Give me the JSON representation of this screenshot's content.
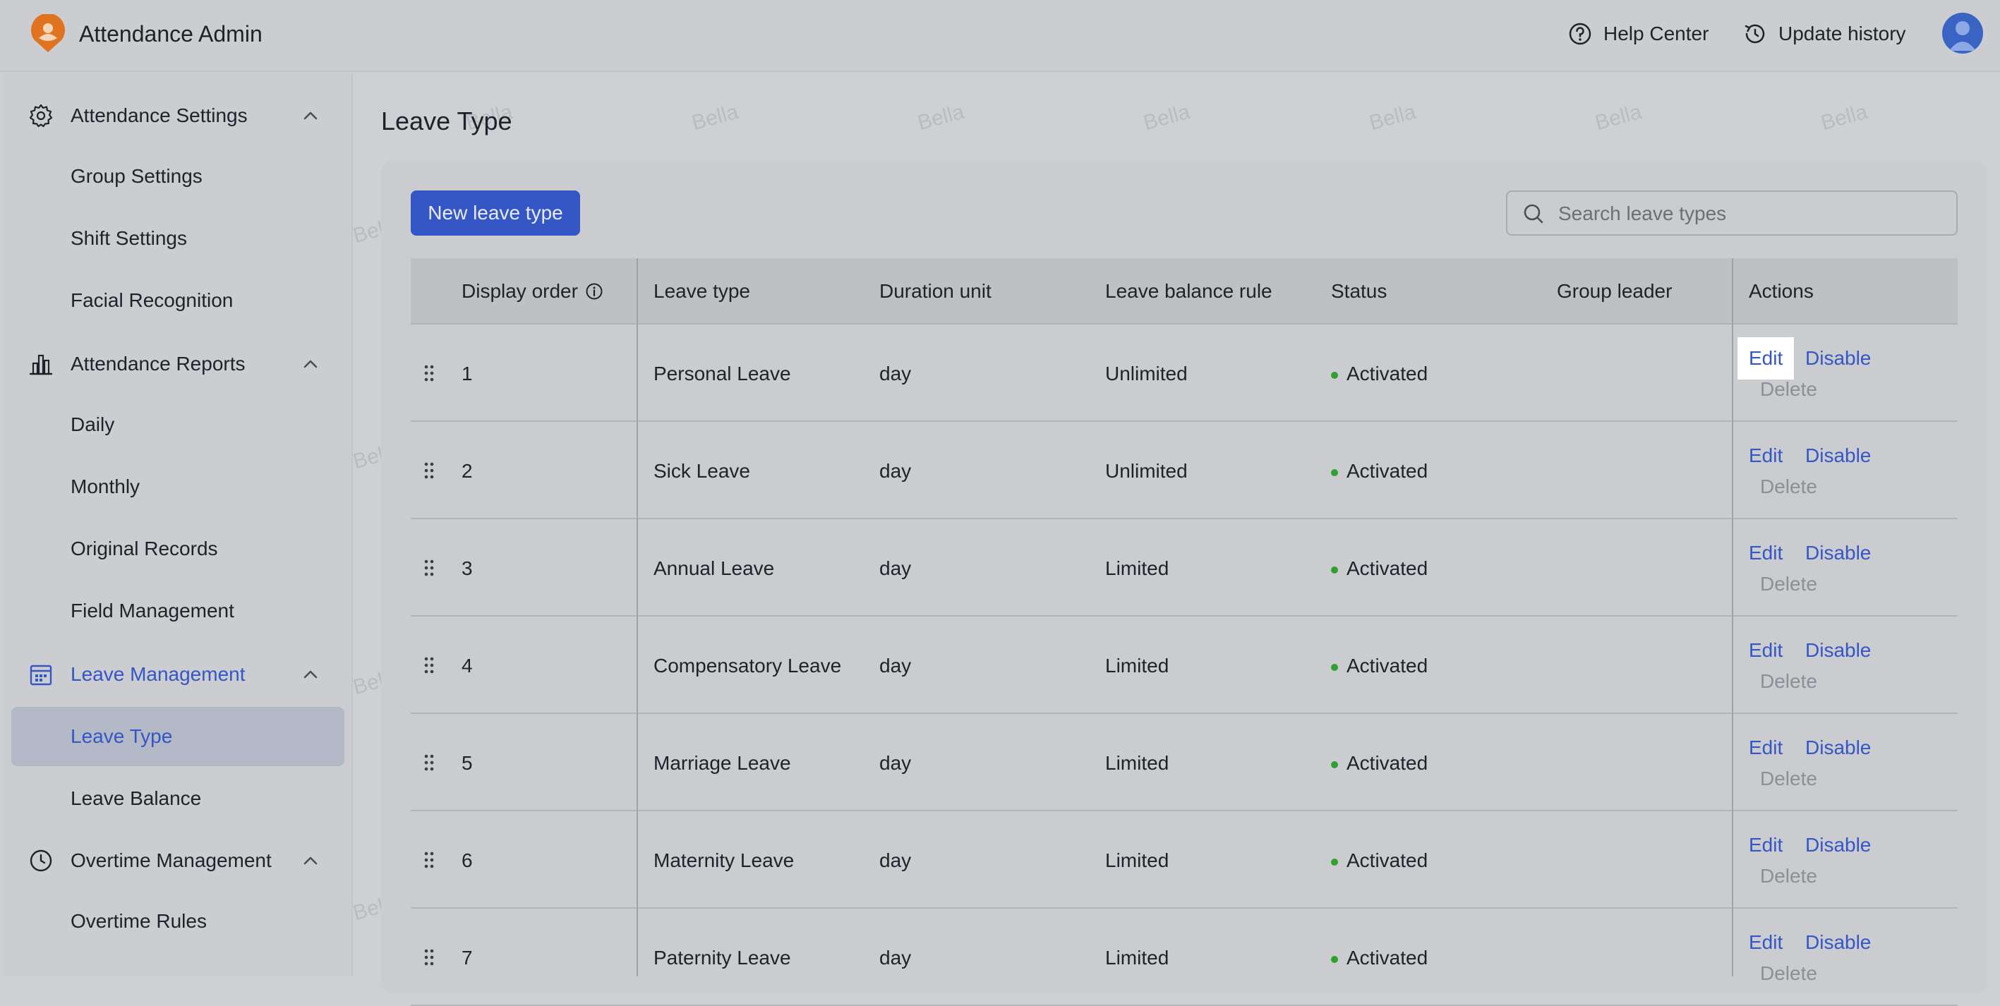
{
  "app": {
    "title": "Attendance Admin"
  },
  "header": {
    "help_label": "Help Center",
    "history_label": "Update history"
  },
  "sidebar": {
    "groups": [
      {
        "label": "Attendance Settings",
        "icon": "gear-icon",
        "items": [
          "Group Settings",
          "Shift Settings",
          "Facial Recognition"
        ]
      },
      {
        "label": "Attendance Reports",
        "icon": "bar-chart-icon",
        "items": [
          "Daily",
          "Monthly",
          "Original Records",
          "Field Management"
        ]
      },
      {
        "label": "Leave Management",
        "icon": "calendar-icon",
        "items": [
          "Leave Type",
          "Leave Balance"
        ]
      },
      {
        "label": "Overtime Management",
        "icon": "clock-icon",
        "items": [
          "Overtime Rules"
        ]
      }
    ],
    "active_item": "Leave Type",
    "active_color": "#3556c5"
  },
  "main": {
    "title": "Leave Type",
    "new_button_label": "New leave type",
    "search_placeholder": "Search leave types"
  },
  "table": {
    "columns": [
      "Display order",
      "Leave type",
      "Duration unit",
      "Leave balance rule",
      "Status",
      "Group leader",
      "Actions"
    ],
    "rows": [
      {
        "order": "1",
        "type": "Personal Leave",
        "unit": "day",
        "rule": "Unlimited",
        "status": "Activated",
        "leader": ""
      },
      {
        "order": "2",
        "type": "Sick Leave",
        "unit": "day",
        "rule": "Unlimited",
        "status": "Activated",
        "leader": ""
      },
      {
        "order": "3",
        "type": "Annual Leave",
        "unit": "day",
        "rule": "Limited",
        "status": "Activated",
        "leader": ""
      },
      {
        "order": "4",
        "type": "Compensatory Leave",
        "unit": "day",
        "rule": "Limited",
        "status": "Activated",
        "leader": ""
      },
      {
        "order": "5",
        "type": "Marriage Leave",
        "unit": "day",
        "rule": "Limited",
        "status": "Activated",
        "leader": ""
      },
      {
        "order": "6",
        "type": "Maternity Leave",
        "unit": "day",
        "rule": "Limited",
        "status": "Activated",
        "leader": ""
      },
      {
        "order": "7",
        "type": "Paternity Leave",
        "unit": "day",
        "rule": "Limited",
        "status": "Activated",
        "leader": ""
      }
    ],
    "actions": {
      "edit": "Edit",
      "disable": "Disable",
      "delete": "Delete"
    },
    "status_color": "#2ea12e"
  },
  "watermark": "Bella"
}
